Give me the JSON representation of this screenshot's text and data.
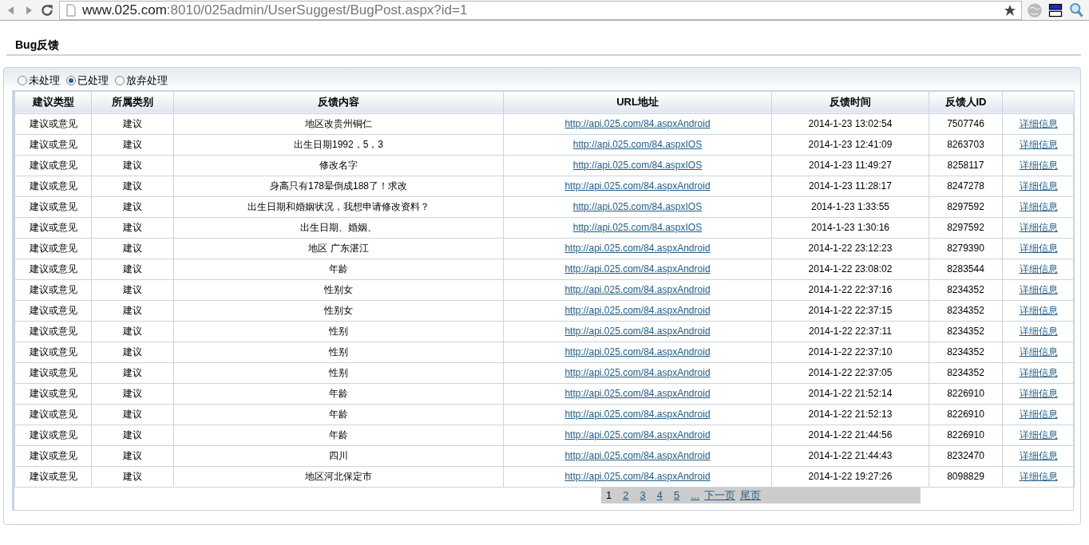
{
  "browser": {
    "url_host": "www.025.com",
    "url_path": ":8010/025admin/UserSuggest/BugPost.aspx?id=1"
  },
  "page_title": "Bug反馈",
  "filters": [
    {
      "label": "未处理",
      "selected": false
    },
    {
      "label": "已处理",
      "selected": true
    },
    {
      "label": "放弃处理",
      "selected": false
    }
  ],
  "table": {
    "columns": [
      "建议类型",
      "所属类别",
      "反馈内容",
      "URL地址",
      "反馈时间",
      "反馈人ID",
      ""
    ],
    "rows": [
      [
        "建议或意见",
        "建议",
        "地区改贵州铜仁",
        "http://api.025.com/84.aspxAndroid",
        "2014-1-23 13:02:54",
        "7507746",
        "详细信息"
      ],
      [
        "建议或意见",
        "建议",
        "出生日期1992，5，3",
        "http://api.025.com/84.aspxIOS",
        "2014-1-23 12:41:09",
        "8263703",
        "详细信息"
      ],
      [
        "建议或意见",
        "建议",
        "修改名字",
        "http://api.025.com/84.aspxIOS",
        "2014-1-23 11:49:27",
        "8258117",
        "详细信息"
      ],
      [
        "建议或意见",
        "建议",
        "身高只有178晕倒成188了！求改",
        "http://api.025.com/84.aspxAndroid",
        "2014-1-23 11:28:17",
        "8247278",
        "详细信息"
      ],
      [
        "建议或意见",
        "建议",
        "出生日期和婚姻状况，我想申请修改资料？",
        "http://api.025.com/84.aspxIOS",
        "2014-1-23 1:33:55",
        "8297592",
        "详细信息"
      ],
      [
        "建议或意见",
        "建议",
        "出生日期、婚姻、",
        "http://api.025.com/84.aspxIOS",
        "2014-1-23 1:30:16",
        "8297592",
        "详细信息"
      ],
      [
        "建议或意见",
        "建议",
        "地区 广东湛江",
        "http://api.025.com/84.aspxAndroid",
        "2014-1-22 23:12:23",
        "8279390",
        "详细信息"
      ],
      [
        "建议或意见",
        "建议",
        "年龄",
        "http://api.025.com/84.aspxAndroid",
        "2014-1-22 23:08:02",
        "8283544",
        "详细信息"
      ],
      [
        "建议或意见",
        "建议",
        "性别女",
        "http://api.025.com/84.aspxAndroid",
        "2014-1-22 22:37:16",
        "8234352",
        "详细信息"
      ],
      [
        "建议或意见",
        "建议",
        "性别女",
        "http://api.025.com/84.aspxAndroid",
        "2014-1-22 22:37:15",
        "8234352",
        "详细信息"
      ],
      [
        "建议或意见",
        "建议",
        "性别",
        "http://api.025.com/84.aspxAndroid",
        "2014-1-22 22:37:11",
        "8234352",
        "详细信息"
      ],
      [
        "建议或意见",
        "建议",
        "性别",
        "http://api.025.com/84.aspxAndroid",
        "2014-1-22 22:37:10",
        "8234352",
        "详细信息"
      ],
      [
        "建议或意见",
        "建议",
        "性别",
        "http://api.025.com/84.aspxAndroid",
        "2014-1-22 22:37:05",
        "8234352",
        "详细信息"
      ],
      [
        "建议或意见",
        "建议",
        "年龄",
        "http://api.025.com/84.aspxAndroid",
        "2014-1-22 21:52:14",
        "8226910",
        "详细信息"
      ],
      [
        "建议或意见",
        "建议",
        "年龄",
        "http://api.025.com/84.aspxAndroid",
        "2014-1-22 21:52:13",
        "8226910",
        "详细信息"
      ],
      [
        "建议或意见",
        "建议",
        "年龄",
        "http://api.025.com/84.aspxAndroid",
        "2014-1-22 21:44:56",
        "8226910",
        "详细信息"
      ],
      [
        "建议或意见",
        "建议",
        "四川",
        "http://api.025.com/84.aspxAndroid",
        "2014-1-22 21:44:43",
        "8232470",
        "详细信息"
      ],
      [
        "建议或意见",
        "建议",
        "地区河北保定市",
        "http://api.025.com/84.aspxAndroid",
        "2014-1-22 19:27:26",
        "8098829",
        "详细信息"
      ]
    ]
  },
  "pagination": [
    {
      "label": "1",
      "selected": true
    },
    {
      "label": "2",
      "selected": false
    },
    {
      "label": "3",
      "selected": false
    },
    {
      "label": "4",
      "selected": false
    },
    {
      "label": "5",
      "selected": false
    },
    {
      "label": "...",
      "selected": false
    },
    {
      "label": "下一页",
      "selected": false
    },
    {
      "label": "尾页",
      "selected": false
    }
  ]
}
